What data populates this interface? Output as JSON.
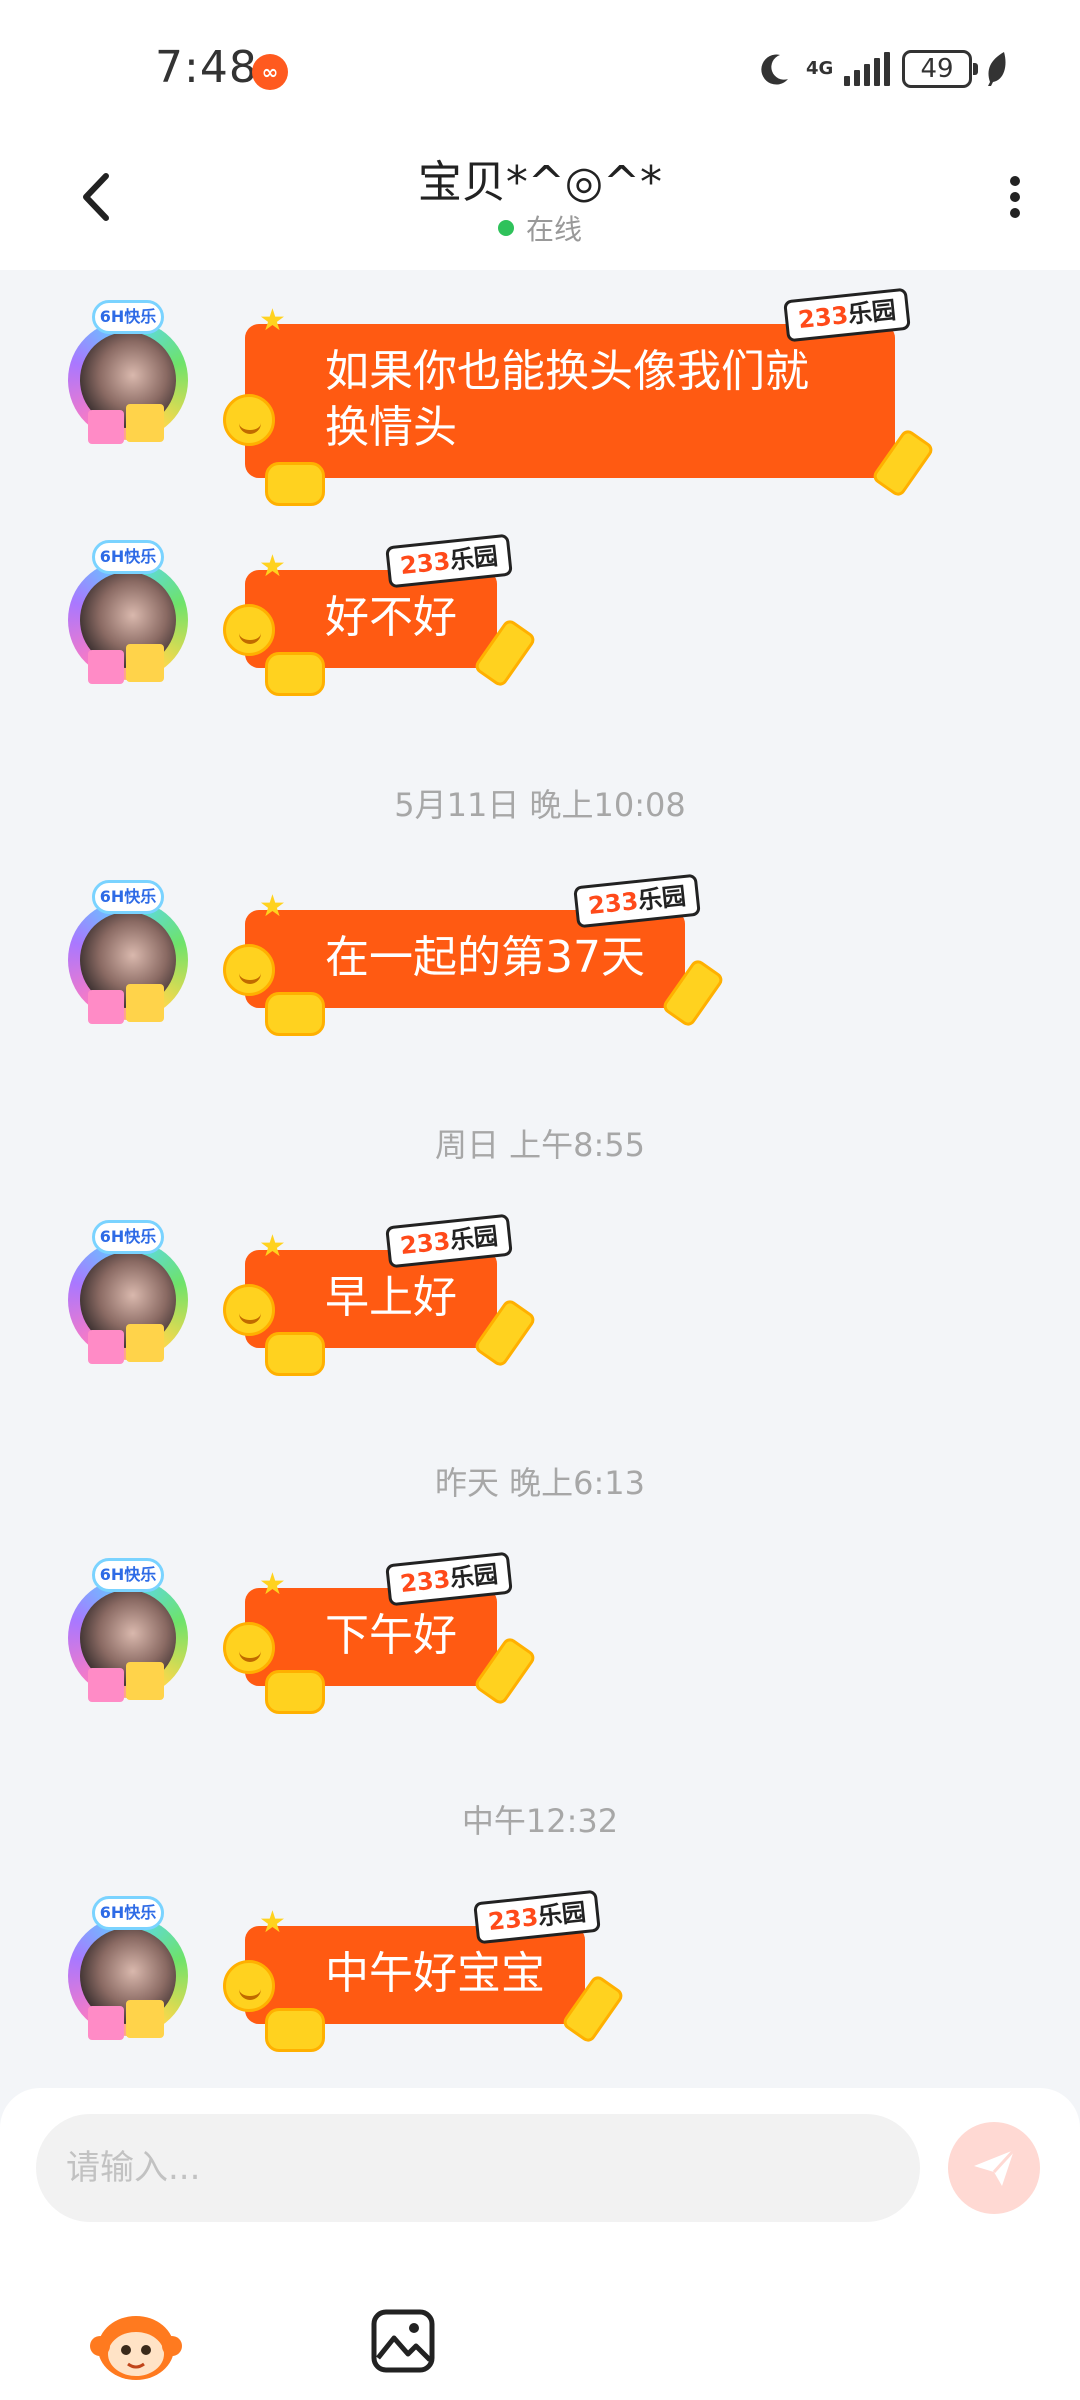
{
  "status_bar": {
    "time": "7:48",
    "network": "4G",
    "battery": "49"
  },
  "header": {
    "title": "宝贝*^◎^*",
    "status": "在线"
  },
  "messages": [
    {
      "text_line1": "如果你也能换头像我们就",
      "text_line2": "换情头",
      "tag_num": "233",
      "tag_text": "乐园"
    },
    {
      "text": "好不好",
      "tag_num": "233",
      "tag_text": "乐园"
    },
    {
      "text": "在一起的第37天",
      "tag_num": "233",
      "tag_text": "乐园"
    },
    {
      "text": "早上好",
      "tag_num": "233",
      "tag_text": "乐园"
    },
    {
      "text": "下午好",
      "tag_num": "233",
      "tag_text": "乐园"
    },
    {
      "text": "中午好宝宝",
      "tag_num": "233",
      "tag_text": "乐园"
    }
  ],
  "timestamps": [
    "5月11日 晚上10:08",
    "周日 上午8:55",
    "昨天 晚上6:13",
    "中午12:32"
  ],
  "avatar_badge": "6H快乐",
  "input": {
    "placeholder": "请输入..."
  },
  "colors": {
    "bubble": "#ff5a12",
    "background": "#f3f5f8",
    "online_dot": "#2fc25b",
    "send_button": "#ffd9d3"
  }
}
